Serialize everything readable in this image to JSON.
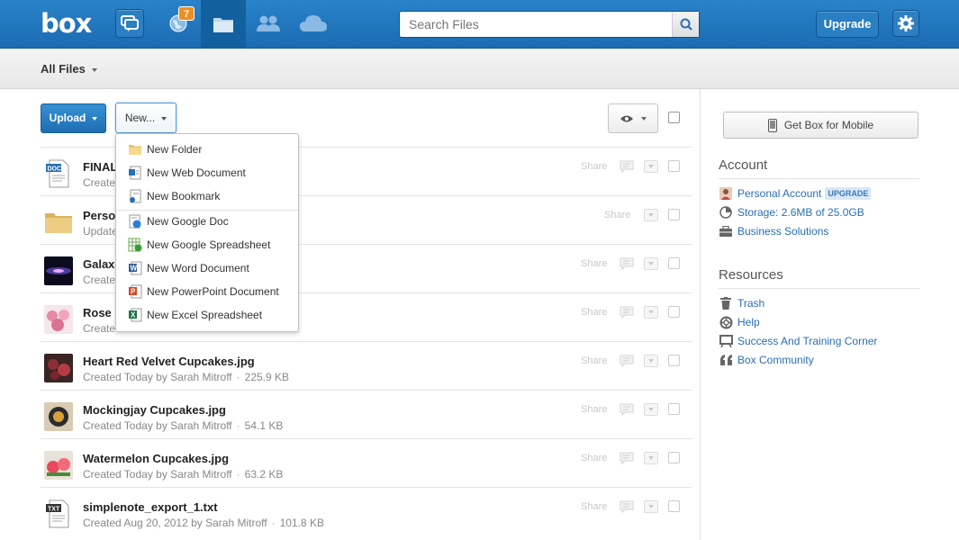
{
  "brand": {
    "logo_text": "box"
  },
  "topbar": {
    "notifications_badge": "7",
    "search_placeholder": "Search Files",
    "upgrade_label": "Upgrade",
    "nav_icons": [
      "chat-icon",
      "updates-globe-icon",
      "files-folder-icon",
      "collaborators-icon",
      "cloud-icon",
      "gear-icon"
    ]
  },
  "breadcrumb": {
    "label": "All Files"
  },
  "toolbar": {
    "upload_label": "Upload",
    "new_label": "New..."
  },
  "new_menu": {
    "items": [
      {
        "label": "New Folder",
        "icon": "folder-icon"
      },
      {
        "label": "New Web Document",
        "icon": "web-document-icon"
      },
      {
        "label": "New Bookmark",
        "icon": "bookmark-icon"
      },
      {
        "label": "New Google Doc",
        "icon": "google-doc-icon"
      },
      {
        "label": "New Google Spreadsheet",
        "icon": "google-spreadsheet-icon"
      },
      {
        "label": "New Word Document",
        "icon": "word-document-icon"
      },
      {
        "label": "New PowerPoint Document",
        "icon": "powerpoint-document-icon"
      },
      {
        "label": "New Excel Spreadsheet",
        "icon": "excel-spreadsheet-icon"
      }
    ]
  },
  "files": [
    {
      "name": "FINAL",
      "meta": "Create",
      "size": "",
      "share": "Share",
      "thumb": "doc"
    },
    {
      "name": "Perso",
      "meta": "Update",
      "size": "",
      "share": "Share",
      "thumb": "folder"
    },
    {
      "name": "Galax",
      "meta": "Create",
      "size": "",
      "share": "Share",
      "thumb": "galaxy"
    },
    {
      "name": "Rose",
      "meta": "Create",
      "size": "",
      "share": "Share",
      "thumb": "rose"
    },
    {
      "name": "Heart Red Velvet Cupcakes.jpg",
      "meta": "Created Today by Sarah Mitroff",
      "size": "225.9 KB",
      "share": "Share",
      "thumb": "heart"
    },
    {
      "name": "Mockingjay Cupcakes.jpg",
      "meta": "Created Today by Sarah Mitroff",
      "size": "54.1 KB",
      "share": "Share",
      "thumb": "mockingjay"
    },
    {
      "name": "Watermelon Cupcakes.jpg",
      "meta": "Created Today by Sarah Mitroff",
      "size": "63.2 KB",
      "share": "Share",
      "thumb": "watermelon"
    },
    {
      "name": "simplenote_export_1.txt",
      "meta": "Created Aug 20, 2012 by Sarah Mitroff",
      "size": "101.8 KB",
      "share": "Share",
      "thumb": "txt"
    }
  ],
  "sidebar": {
    "mobile_label": "Get Box for Mobile",
    "account_heading": "Account",
    "account_links": [
      {
        "label": "Personal Account",
        "tag": "UPGRADE",
        "icon": "avatar-icon"
      },
      {
        "label": "Storage: 2.6MB of 25.0GB",
        "icon": "storage-pie-icon"
      },
      {
        "label": "Business Solutions",
        "icon": "briefcase-icon"
      }
    ],
    "resources_heading": "Resources",
    "resource_links": [
      {
        "label": "Trash",
        "icon": "trash-icon"
      },
      {
        "label": "Help",
        "icon": "help-lifebuoy-icon"
      },
      {
        "label": "Success And Training Corner",
        "icon": "training-board-icon"
      },
      {
        "label": "Box Community",
        "icon": "quote-icon"
      }
    ]
  },
  "colors": {
    "brand_blue": "#1f72ba",
    "link_blue": "#2a6eb5",
    "badge_orange": "#f28c1e"
  }
}
